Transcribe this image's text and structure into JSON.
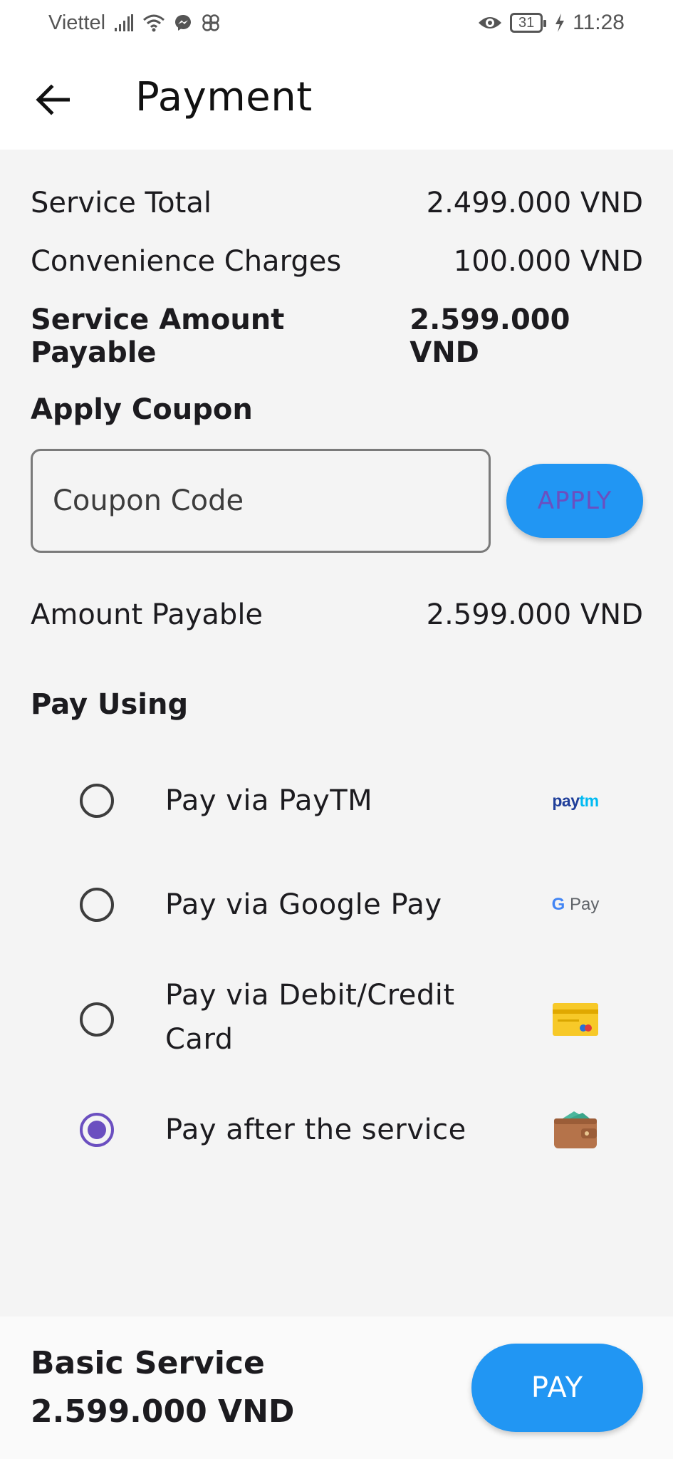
{
  "status_bar": {
    "carrier": "Viettel",
    "battery": "31",
    "time": "11:28"
  },
  "app_bar": {
    "title": "Payment"
  },
  "summary": {
    "service_total_label": "Service Total",
    "service_total_value": "2.499.000 VND",
    "convenience_label": "Convenience Charges",
    "convenience_value": "100.000 VND",
    "payable_label": "Service Amount Payable",
    "payable_value": "2.599.000 VND"
  },
  "coupon": {
    "title": "Apply Coupon",
    "placeholder": "Coupon Code",
    "value": "",
    "apply_label": "APPLY"
  },
  "amount_payable": {
    "label": "Amount Payable",
    "value": "2.599.000 VND"
  },
  "pay_using": {
    "title": "Pay Using",
    "options": [
      {
        "label": "Pay via PayTM",
        "icon": "paytm-logo-icon",
        "selected": false
      },
      {
        "label": "Pay via Google Pay",
        "icon": "google-pay-logo-icon",
        "selected": false
      },
      {
        "label": "Pay via Debit/Credit Card",
        "icon": "credit-card-icon",
        "selected": false
      },
      {
        "label": "Pay after the service",
        "icon": "wallet-icon",
        "selected": true
      }
    ],
    "paytm_logo_pay": "pay",
    "paytm_logo_tm": "tm",
    "gpay_logo_g": "G",
    "gpay_logo_pay": "Pay"
  },
  "bottom_bar": {
    "service_name": "Basic Service",
    "amount": "2.599.000 VND",
    "pay_label": "PAY"
  },
  "colors": {
    "accent_blue": "#2196f3",
    "radio_selected": "#6b4fc0",
    "background": "#f4f4f4"
  }
}
